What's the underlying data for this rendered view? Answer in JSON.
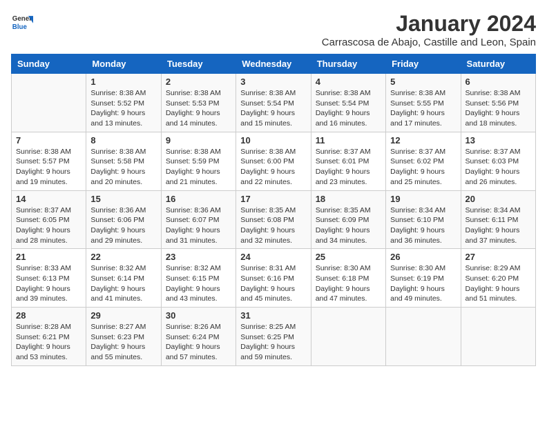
{
  "header": {
    "logo_general": "General",
    "logo_blue": "Blue",
    "title": "January 2024",
    "subtitle": "Carrascosa de Abajo, Castille and Leon, Spain"
  },
  "columns": [
    "Sunday",
    "Monday",
    "Tuesday",
    "Wednesday",
    "Thursday",
    "Friday",
    "Saturday"
  ],
  "weeks": [
    [
      {
        "day": "",
        "content": ""
      },
      {
        "day": "1",
        "content": "Sunrise: 8:38 AM\nSunset: 5:52 PM\nDaylight: 9 hours\nand 13 minutes."
      },
      {
        "day": "2",
        "content": "Sunrise: 8:38 AM\nSunset: 5:53 PM\nDaylight: 9 hours\nand 14 minutes."
      },
      {
        "day": "3",
        "content": "Sunrise: 8:38 AM\nSunset: 5:54 PM\nDaylight: 9 hours\nand 15 minutes."
      },
      {
        "day": "4",
        "content": "Sunrise: 8:38 AM\nSunset: 5:54 PM\nDaylight: 9 hours\nand 16 minutes."
      },
      {
        "day": "5",
        "content": "Sunrise: 8:38 AM\nSunset: 5:55 PM\nDaylight: 9 hours\nand 17 minutes."
      },
      {
        "day": "6",
        "content": "Sunrise: 8:38 AM\nSunset: 5:56 PM\nDaylight: 9 hours\nand 18 minutes."
      }
    ],
    [
      {
        "day": "7",
        "content": "Sunrise: 8:38 AM\nSunset: 5:57 PM\nDaylight: 9 hours\nand 19 minutes."
      },
      {
        "day": "8",
        "content": "Sunrise: 8:38 AM\nSunset: 5:58 PM\nDaylight: 9 hours\nand 20 minutes."
      },
      {
        "day": "9",
        "content": "Sunrise: 8:38 AM\nSunset: 5:59 PM\nDaylight: 9 hours\nand 21 minutes."
      },
      {
        "day": "10",
        "content": "Sunrise: 8:38 AM\nSunset: 6:00 PM\nDaylight: 9 hours\nand 22 minutes."
      },
      {
        "day": "11",
        "content": "Sunrise: 8:37 AM\nSunset: 6:01 PM\nDaylight: 9 hours\nand 23 minutes."
      },
      {
        "day": "12",
        "content": "Sunrise: 8:37 AM\nSunset: 6:02 PM\nDaylight: 9 hours\nand 25 minutes."
      },
      {
        "day": "13",
        "content": "Sunrise: 8:37 AM\nSunset: 6:03 PM\nDaylight: 9 hours\nand 26 minutes."
      }
    ],
    [
      {
        "day": "14",
        "content": "Sunrise: 8:37 AM\nSunset: 6:05 PM\nDaylight: 9 hours\nand 28 minutes."
      },
      {
        "day": "15",
        "content": "Sunrise: 8:36 AM\nSunset: 6:06 PM\nDaylight: 9 hours\nand 29 minutes."
      },
      {
        "day": "16",
        "content": "Sunrise: 8:36 AM\nSunset: 6:07 PM\nDaylight: 9 hours\nand 31 minutes."
      },
      {
        "day": "17",
        "content": "Sunrise: 8:35 AM\nSunset: 6:08 PM\nDaylight: 9 hours\nand 32 minutes."
      },
      {
        "day": "18",
        "content": "Sunrise: 8:35 AM\nSunset: 6:09 PM\nDaylight: 9 hours\nand 34 minutes."
      },
      {
        "day": "19",
        "content": "Sunrise: 8:34 AM\nSunset: 6:10 PM\nDaylight: 9 hours\nand 36 minutes."
      },
      {
        "day": "20",
        "content": "Sunrise: 8:34 AM\nSunset: 6:11 PM\nDaylight: 9 hours\nand 37 minutes."
      }
    ],
    [
      {
        "day": "21",
        "content": "Sunrise: 8:33 AM\nSunset: 6:13 PM\nDaylight: 9 hours\nand 39 minutes."
      },
      {
        "day": "22",
        "content": "Sunrise: 8:32 AM\nSunset: 6:14 PM\nDaylight: 9 hours\nand 41 minutes."
      },
      {
        "day": "23",
        "content": "Sunrise: 8:32 AM\nSunset: 6:15 PM\nDaylight: 9 hours\nand 43 minutes."
      },
      {
        "day": "24",
        "content": "Sunrise: 8:31 AM\nSunset: 6:16 PM\nDaylight: 9 hours\nand 45 minutes."
      },
      {
        "day": "25",
        "content": "Sunrise: 8:30 AM\nSunset: 6:18 PM\nDaylight: 9 hours\nand 47 minutes."
      },
      {
        "day": "26",
        "content": "Sunrise: 8:30 AM\nSunset: 6:19 PM\nDaylight: 9 hours\nand 49 minutes."
      },
      {
        "day": "27",
        "content": "Sunrise: 8:29 AM\nSunset: 6:20 PM\nDaylight: 9 hours\nand 51 minutes."
      }
    ],
    [
      {
        "day": "28",
        "content": "Sunrise: 8:28 AM\nSunset: 6:21 PM\nDaylight: 9 hours\nand 53 minutes."
      },
      {
        "day": "29",
        "content": "Sunrise: 8:27 AM\nSunset: 6:23 PM\nDaylight: 9 hours\nand 55 minutes."
      },
      {
        "day": "30",
        "content": "Sunrise: 8:26 AM\nSunset: 6:24 PM\nDaylight: 9 hours\nand 57 minutes."
      },
      {
        "day": "31",
        "content": "Sunrise: 8:25 AM\nSunset: 6:25 PM\nDaylight: 9 hours\nand 59 minutes."
      },
      {
        "day": "",
        "content": ""
      },
      {
        "day": "",
        "content": ""
      },
      {
        "day": "",
        "content": ""
      }
    ]
  ]
}
